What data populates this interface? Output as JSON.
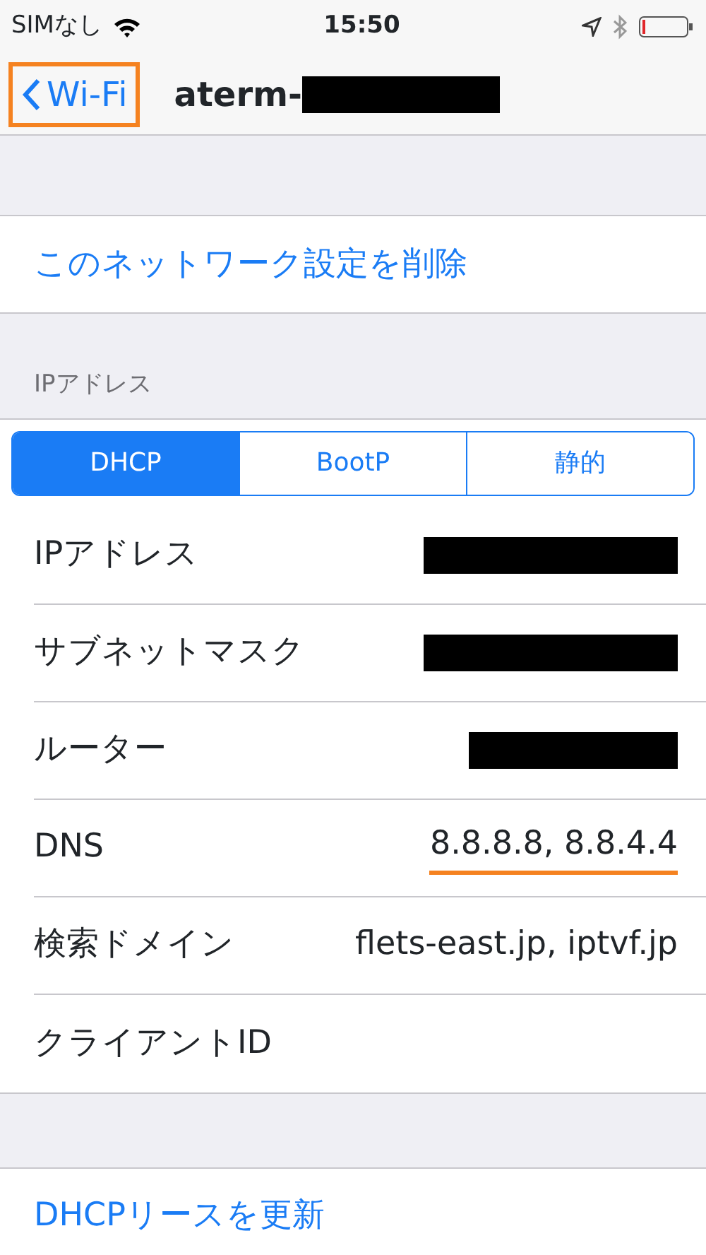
{
  "status_bar": {
    "carrier": "SIMなし",
    "time": "15:50"
  },
  "nav": {
    "back": {
      "label": "Wi-Fi",
      "highlighted": true
    },
    "title": "aterm-",
    "title_redacted": true
  },
  "delete_action": "このネットワーク設定を削除",
  "section_header": "IPアドレス",
  "segments": [
    {
      "label": "DHCP",
      "selected": true
    },
    {
      "label": "BootP",
      "selected": false
    },
    {
      "label": "静的",
      "selected": false
    }
  ],
  "rows": [
    {
      "label": "IPアドレス",
      "redacted": true,
      "underlined": false
    },
    {
      "label": "サブネットマスク",
      "redacted": true,
      "underlined": false
    },
    {
      "label": "ルーター",
      "redacted": true,
      "underlined": false
    },
    {
      "label": "DNS",
      "value": "8.8.8.8, 8.8.4.4",
      "redacted": false,
      "underlined": true
    },
    {
      "label": "検索ドメイン",
      "value": "flets-east.jp, iptvf.jp",
      "redacted": false,
      "underlined": false
    },
    {
      "label": "クライアントID",
      "redacted": false,
      "underlined": false
    }
  ],
  "renew_action": "DHCPリースを更新"
}
